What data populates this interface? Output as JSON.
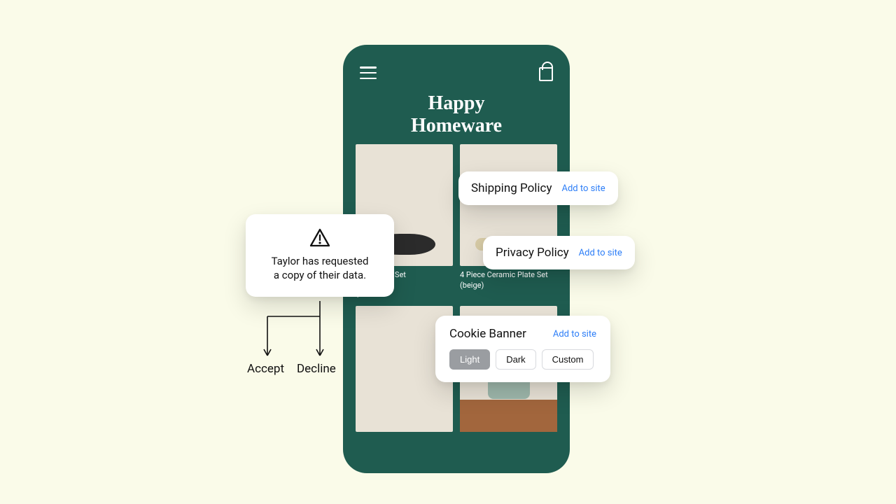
{
  "brand": {
    "line1": "Happy",
    "line2": "Homeware"
  },
  "products": [
    {
      "name": "…mic Plate Set",
      "price": "$34.00",
      "photo": "leaves"
    },
    {
      "name": "4 Piece Ceramic Plate Set (beige)",
      "price": "",
      "photo": "beige"
    },
    {
      "name": "",
      "price": "",
      "photo": "bust"
    },
    {
      "name": "",
      "price": "",
      "photo": "lamp"
    }
  ],
  "callouts": {
    "shipping": {
      "title": "Shipping Policy",
      "link": "Add to site"
    },
    "privacy": {
      "title": "Privacy Policy",
      "link": "Add to site"
    },
    "cookie": {
      "title": "Cookie Banner",
      "link": "Add to site",
      "options": [
        "Light",
        "Dark",
        "Custom"
      ],
      "selected": 0
    }
  },
  "data_request": {
    "message_line1": "Taylor has requested",
    "message_line2": "a copy of their data.",
    "accept_label": "Accept",
    "decline_label": "Decline"
  }
}
